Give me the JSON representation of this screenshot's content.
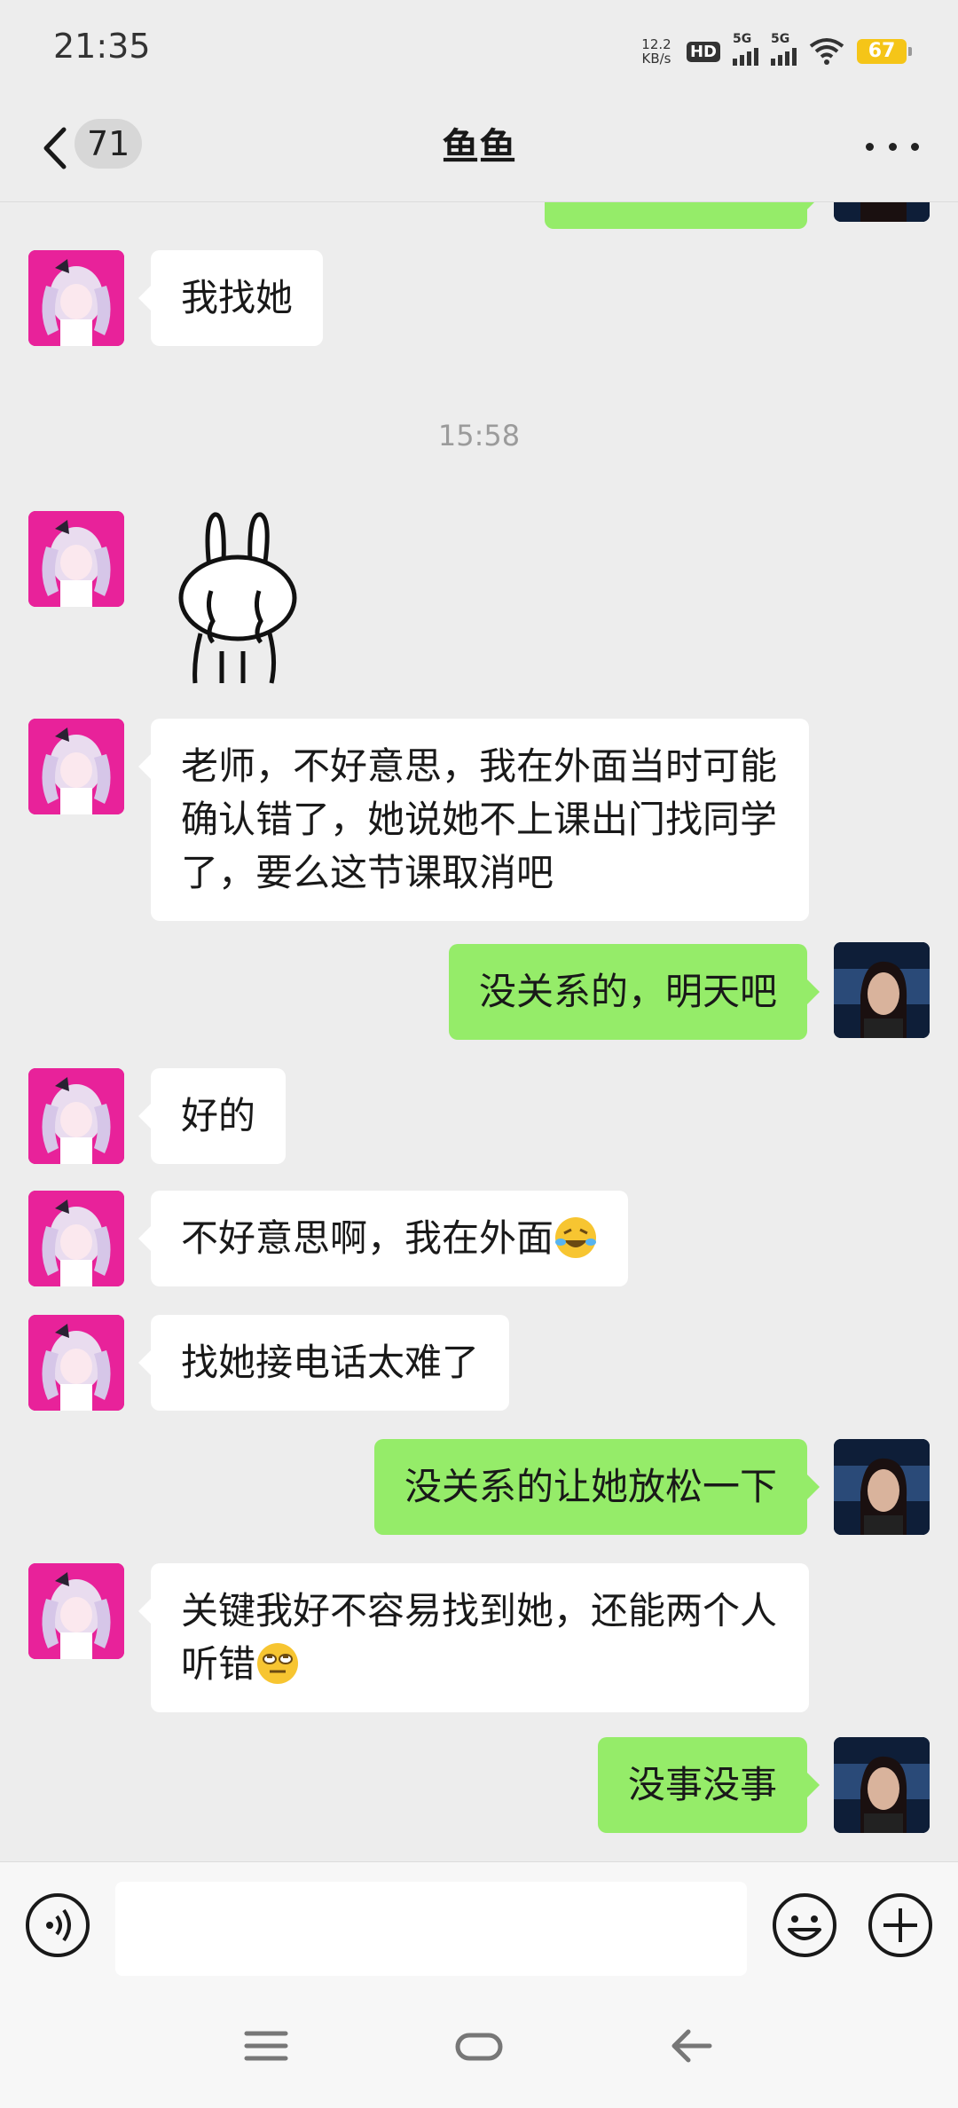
{
  "status_bar": {
    "time": "21:35",
    "net_speed_value": "12.2",
    "net_speed_unit": "KB/s",
    "hd_label": "HD",
    "sim1_label": "5G",
    "sim2_label": "5G",
    "battery": "67"
  },
  "header": {
    "unread_count": "71",
    "title": "鱼鱼"
  },
  "chat": {
    "timestamp": "15:58",
    "messages": [
      {
        "side": "left",
        "text": "我找她"
      },
      {
        "side": "left",
        "type": "sticker",
        "sticker": "crying-rabbit"
      },
      {
        "side": "left",
        "text": "老师，不好意思，我在外面当时可能确认错了，她说她不上课出门找同学了，要么这节课取消吧"
      },
      {
        "side": "right",
        "text": "没关系的，明天吧"
      },
      {
        "side": "left",
        "text": "好的"
      },
      {
        "side": "left",
        "text": "不好意思啊，我在外面",
        "emoji": "laughing-crying-emoji"
      },
      {
        "side": "left",
        "text": "找她接电话太难了"
      },
      {
        "side": "right",
        "text": "没关系的让她放松一下"
      },
      {
        "side": "left",
        "text": "关键我好不容易找到她，还能两个人听错",
        "emoji": "eye-roll-emoji"
      },
      {
        "side": "right",
        "text": "没事没事"
      }
    ]
  },
  "colors": {
    "background": "#ededed",
    "bubble_self": "#95ec69",
    "bubble_other": "#ffffff",
    "girl_avatar_bg": "#e8229a"
  }
}
